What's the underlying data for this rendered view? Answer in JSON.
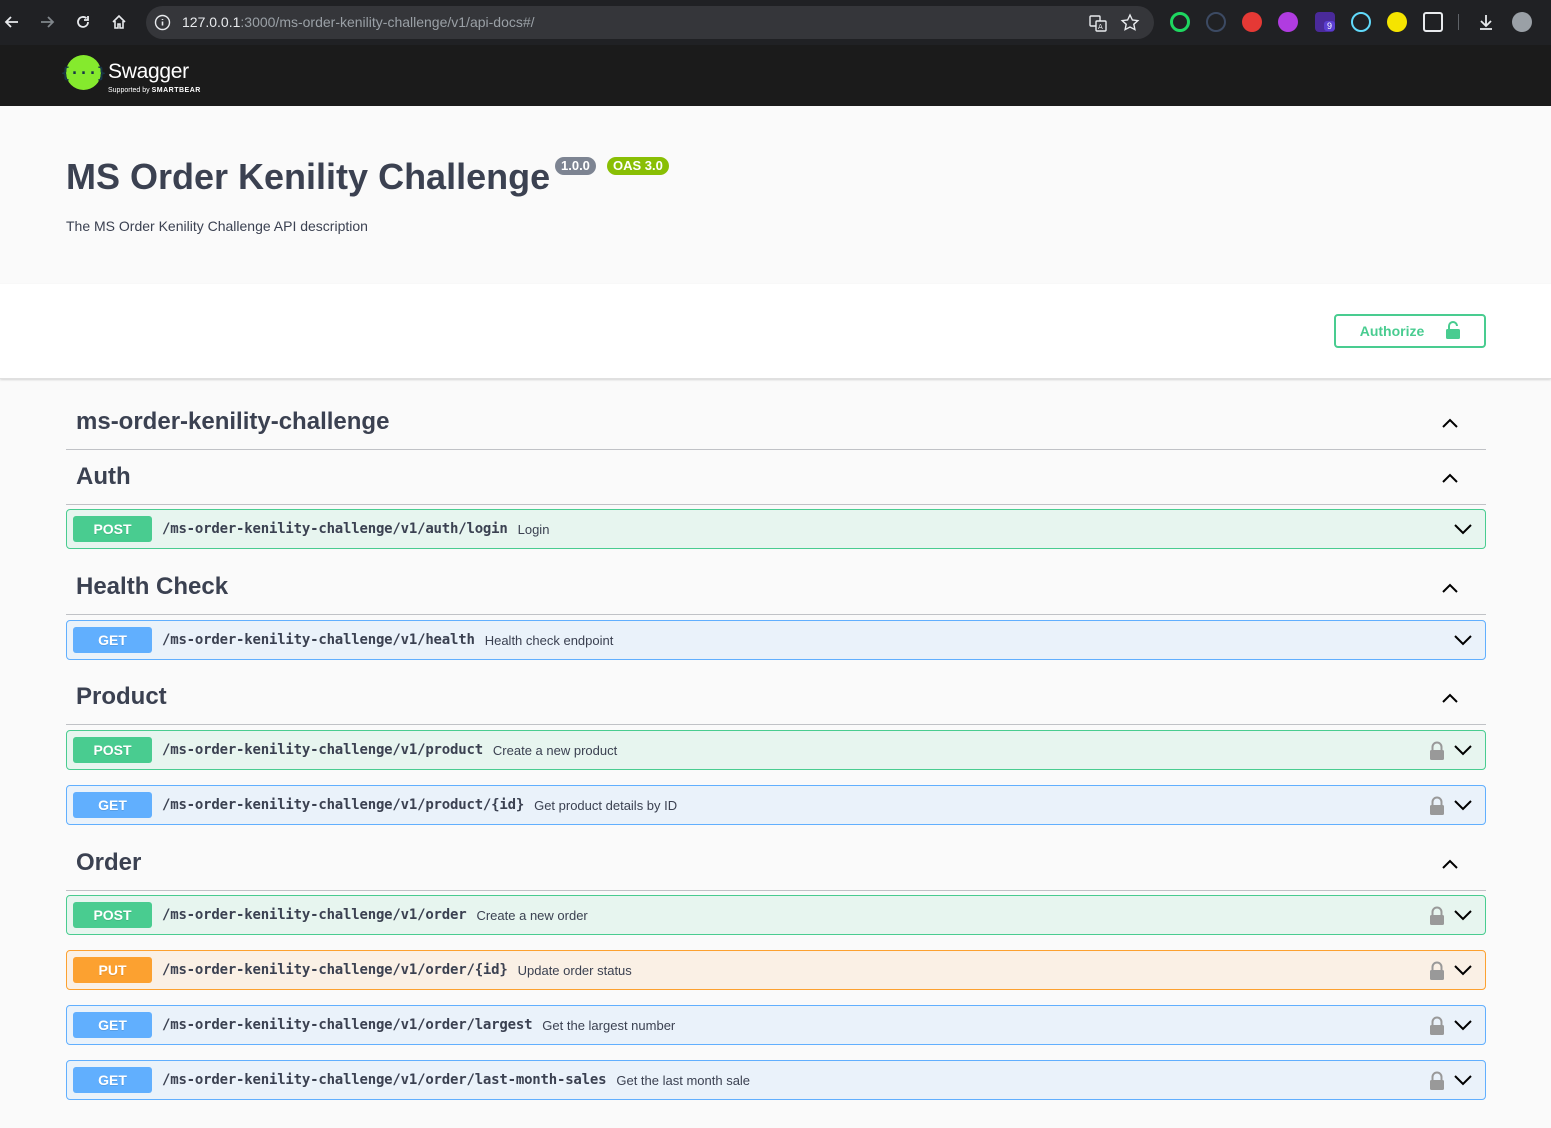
{
  "browser": {
    "url_host": "127.0.0.1",
    "url_rest": ":3000/ms-order-kenility-challenge/v1/api-docs#/",
    "extension_badge": "9"
  },
  "topbar": {
    "logo_text": "Swagger",
    "logo_sub_prefix": "Supported by",
    "logo_sub_brand": "SMARTBEAR"
  },
  "info": {
    "title": "MS Order Kenility Challenge",
    "version": "1.0.0",
    "oas": "OAS 3.0",
    "description": "The MS Order Kenility Challenge API description"
  },
  "scheme": {
    "authorize_label": "Authorize"
  },
  "colors": {
    "post": "#49cc90",
    "get": "#61affe",
    "put": "#fca130",
    "topbar": "#1b1b1b",
    "logo": "#85ea2d"
  },
  "tags": [
    {
      "name": "ms-order-kenility-challenge",
      "operations": []
    },
    {
      "name": "Auth",
      "operations": [
        {
          "method": "POST",
          "path": "/ms-order-kenility-challenge/v1/auth/login",
          "summary": "Login",
          "locked": false
        }
      ]
    },
    {
      "name": "Health Check",
      "operations": [
        {
          "method": "GET",
          "path": "/ms-order-kenility-challenge/v1/health",
          "summary": "Health check endpoint",
          "locked": false
        }
      ]
    },
    {
      "name": "Product",
      "operations": [
        {
          "method": "POST",
          "path": "/ms-order-kenility-challenge/v1/product",
          "summary": "Create a new product",
          "locked": true
        },
        {
          "method": "GET",
          "path": "/ms-order-kenility-challenge/v1/product/{id}",
          "summary": "Get product details by ID",
          "locked": true
        }
      ]
    },
    {
      "name": "Order",
      "operations": [
        {
          "method": "POST",
          "path": "/ms-order-kenility-challenge/v1/order",
          "summary": "Create a new order",
          "locked": true
        },
        {
          "method": "PUT",
          "path": "/ms-order-kenility-challenge/v1/order/{id}",
          "summary": "Update order status",
          "locked": true
        },
        {
          "method": "GET",
          "path": "/ms-order-kenility-challenge/v1/order/largest",
          "summary": "Get the largest number",
          "locked": true
        },
        {
          "method": "GET",
          "path": "/ms-order-kenility-challenge/v1/order/last-month-sales",
          "summary": "Get the last month sale",
          "locked": true
        }
      ]
    }
  ]
}
